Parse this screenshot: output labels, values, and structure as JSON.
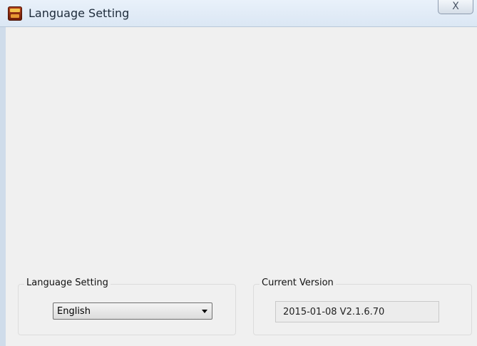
{
  "window": {
    "title": "Language Setting",
    "close_label": "X"
  },
  "language_group": {
    "label": "Language Setting",
    "selected": "English"
  },
  "version_group": {
    "label": "Current Version",
    "value": "2015-01-08 V2.1.6.70"
  },
  "icons": {
    "app": "app-logo-icon",
    "close": "close-icon",
    "dropdown": "chevron-down-icon"
  },
  "colors": {
    "titlebar": "#dbe7f4",
    "client": "#f0f0f0"
  }
}
